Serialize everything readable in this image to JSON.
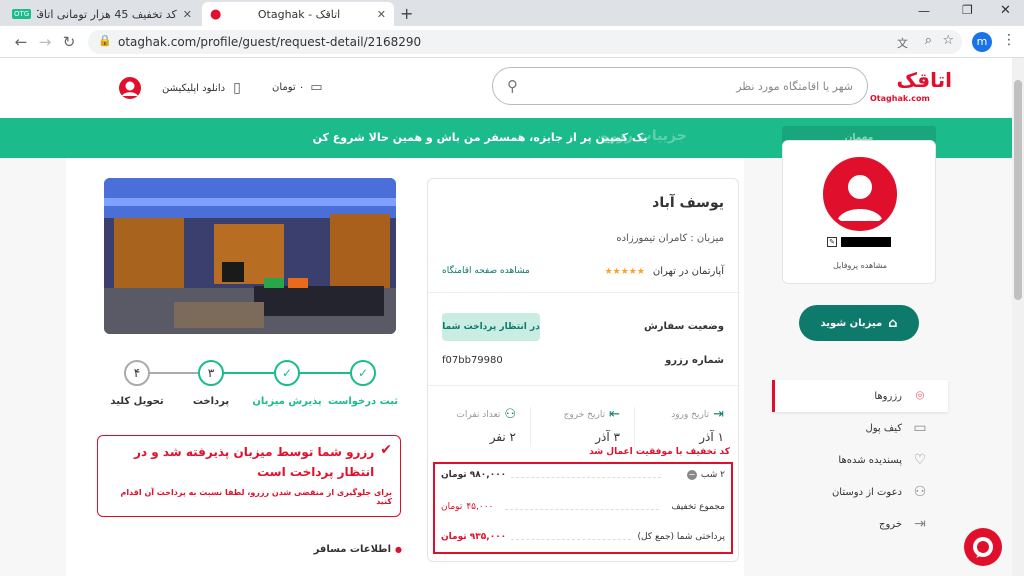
{
  "browser": {
    "tabs": [
      {
        "label": "کد تخفیف 45 هزار تومانی اتاقک برا...",
        "favicon": "OTG"
      },
      {
        "label": "Otaghak - اتاقک",
        "favicon": "pin"
      }
    ],
    "url": "otaghak.com/profile/guest/request-detail/2168290",
    "profile_initial": "m"
  },
  "header": {
    "logo_text": "اتاقک",
    "logo_sub": "Otaghak.com",
    "search_placeholder": "شهر یا اقامتگاه مورد نظر",
    "wallet": "۰ تومان",
    "download_app": "دانلود اپلیکیشن"
  },
  "banner": {
    "text": "یک کمپین پر از جایزه، همسفر من باش و همین حالا شروع کن",
    "faded_title": "جزییات رزرو",
    "faded_tab": "مهمان"
  },
  "profile": {
    "view_profile": "مشاهده پروفایل",
    "become_host": "میزبان شوید"
  },
  "sidebar": {
    "items": [
      {
        "label": "رزروها",
        "icon": "pin-icon",
        "active": true
      },
      {
        "label": "کیف پول",
        "icon": "wallet-icon",
        "active": false
      },
      {
        "label": "پسندیده شده‌ها",
        "icon": "heart-icon",
        "active": false
      },
      {
        "label": "دعوت از دوستان",
        "icon": "invite-icon",
        "active": false
      },
      {
        "label": "خروج",
        "icon": "logout-icon",
        "active": false
      }
    ]
  },
  "listing": {
    "title": "یوسف آباد",
    "host": "میزبان : کامران تیمورزاده",
    "type": "آپارتمان در تهران",
    "stars": 4,
    "view_page": "مشاهده صفحه اقامتگاه",
    "status_label": "وضعیت سفارش",
    "status_value": "در انتظار پرداخت شما",
    "booking_label": "شماره رزرو",
    "booking_value": "f07bb79980",
    "checkin_label": "تاریخ ورود",
    "checkin_value": "۱ آذر",
    "checkout_label": "تاریخ خروج",
    "checkout_value": "۳ آذر",
    "guests_label": "تعداد نفرات",
    "guests_value": "۲ نفر",
    "discount_note": "کد تخفیف با موفقیت اعمال شد",
    "nights_label": "۲ شب",
    "nights_price": "۹۸۰,۰۰۰ تومان",
    "discount_label": "مجموع تخفیف",
    "discount_value": "۴۵,۰۰۰",
    "discount_unit": "تومان",
    "total_label": "پرداختی شما (جمع کل)",
    "total_value": "۹۳۵,۰۰۰ تومان"
  },
  "steps": {
    "items": [
      {
        "num": "۴",
        "label": "تحویل کلید",
        "done": false
      },
      {
        "num": "۳",
        "label": "پرداخت",
        "done": false
      },
      {
        "num": "✓",
        "label": "پذیرش میزبان",
        "done": true
      },
      {
        "num": "✓",
        "label": "ثبت درخواست",
        "done": true
      }
    ]
  },
  "alert": {
    "title": "رزرو شما توسط میزبان پذیرفته شد و در انتظار پرداخت است",
    "body": "برای جلوگیری از منقضی شدن رزرو، لطفا نسبت به پرداخت آن اقدام کنید"
  },
  "guest_info": {
    "title": "اطلاعات مسافر"
  },
  "colors": {
    "brand_red": "#e0102c",
    "brand_green": "#1bbb8b",
    "teal_button": "#0e7a6b"
  }
}
